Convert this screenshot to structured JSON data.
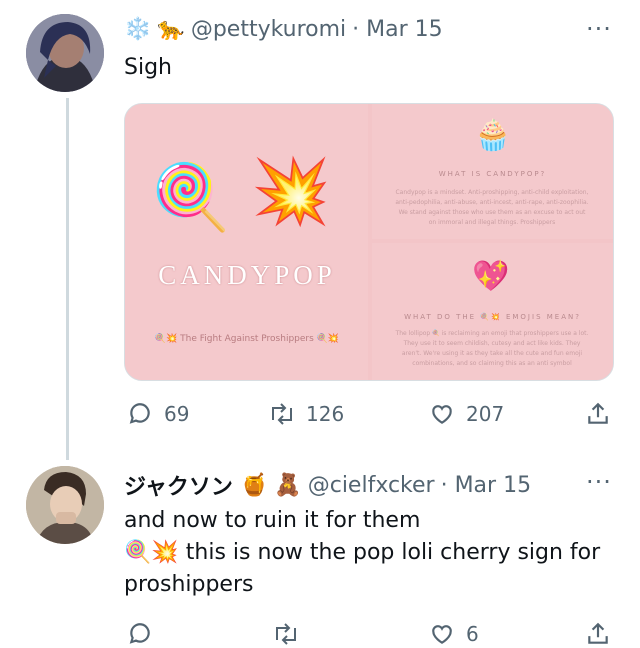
{
  "tweet1": {
    "handle": "@pettykuromi",
    "date": "· Mar 15",
    "badge_emojis": [
      "❄️",
      "🐆"
    ],
    "text": "Sigh",
    "media": {
      "left": {
        "emojis": [
          "🍭",
          "💥"
        ],
        "logo": "CANDYPOP",
        "tagline": "🍭💥 The Fight Against Proshippers 🍭💥"
      },
      "top_right": {
        "emoji": "🧁",
        "title": "WHAT IS CANDYPOP?",
        "body": "Candypop is a mindset. Anti-proshipping, anti-child exploitation, anti-pedophilia, anti-abuse, anti-incest, anti-rape, anti-zoophilia. We stand against those who use them as an excuse to act out on immoral and illegal things. Proshippers"
      },
      "bottom_right": {
        "emoji": "💖",
        "title": "WHAT DO THE 🍭💥 EMOJIS MEAN?",
        "body": "The lollipop 🍭 is reclaiming an emoji that proshippers use a lot. They use it to seem childish, cutesy and act like kids. They aren't. We're using it as they take all the cute and fun emoji combinations, and so claiming this as an anti symbol"
      }
    },
    "actions": {
      "replies": "69",
      "retweets": "126",
      "likes": "207"
    }
  },
  "tweet2": {
    "name": "ジャクソン",
    "badge_emojis": [
      "🍯",
      "🧸"
    ],
    "handle": "@cielfxcker",
    "date": "· Mar 15",
    "line1": "and now to ruin it for them",
    "line2_emojis": "🍭💥",
    "line2": "this is now the pop loli cherry sign for proshippers",
    "actions": {
      "replies": "",
      "retweets": "",
      "likes": "6"
    }
  },
  "more_glyph": "···",
  "colors": {
    "secondary_text": "#536471",
    "primary_text": "#0f1419",
    "media_pink": "#f4c9cc",
    "thread_line": "#cfd9de"
  },
  "icons": [
    "reply-icon",
    "retweet-icon",
    "like-icon",
    "share-icon",
    "more-icon"
  ]
}
